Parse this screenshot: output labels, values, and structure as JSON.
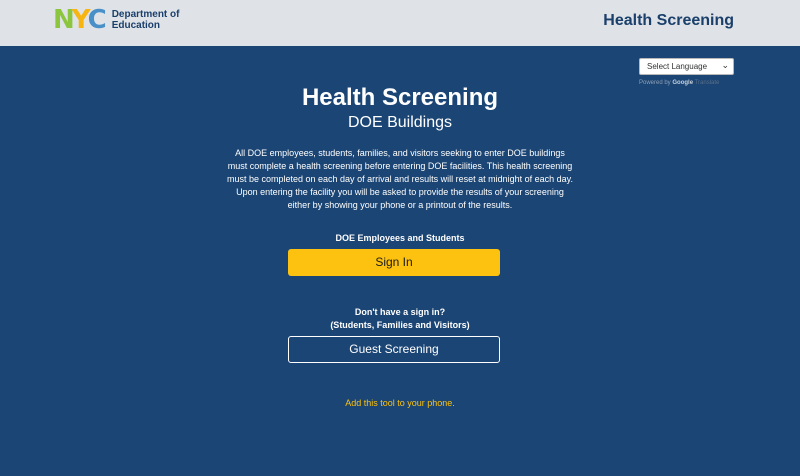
{
  "header": {
    "logo_letters": [
      "N",
      "Y",
      "C"
    ],
    "department_line1": "Department of",
    "department_line2": "Education",
    "title": "Health Screening"
  },
  "language": {
    "select_label": "Select Language",
    "powered_by": "Powered by",
    "google": "Google",
    "translate": "Translate"
  },
  "main": {
    "title": "Health Screening",
    "subtitle": "DOE Buildings",
    "description_lines": [
      "All DOE employees, students, families, and visitors seeking to enter DOE buildings",
      "must complete a health screening before entering DOE facilities. This health screening",
      "must be completed on each day of arrival and results will reset at midnight of each day.",
      "Upon entering the facility you will be asked to provide the results of your screening",
      "either by showing your phone or a printout of the results."
    ],
    "employees_label": "DOE Employees and Students",
    "sign_in_label": "Sign In",
    "no_signin_line1": "Don't have a sign in?",
    "no_signin_line2": "(Students, Families and Visitors)",
    "guest_label": "Guest Screening",
    "add_tool_link": "Add this tool to your phone."
  },
  "colors": {
    "background": "#1b4574",
    "header_bg": "#dfe3e8",
    "accent_yellow": "#fdc20f",
    "nyc_green": "#8cc63f",
    "nyc_yellow": "#f7b512",
    "nyc_blue": "#4a90c8",
    "header_text": "#1b3f6b"
  },
  "icons": {
    "dropdown": "chevron-down-icon"
  }
}
